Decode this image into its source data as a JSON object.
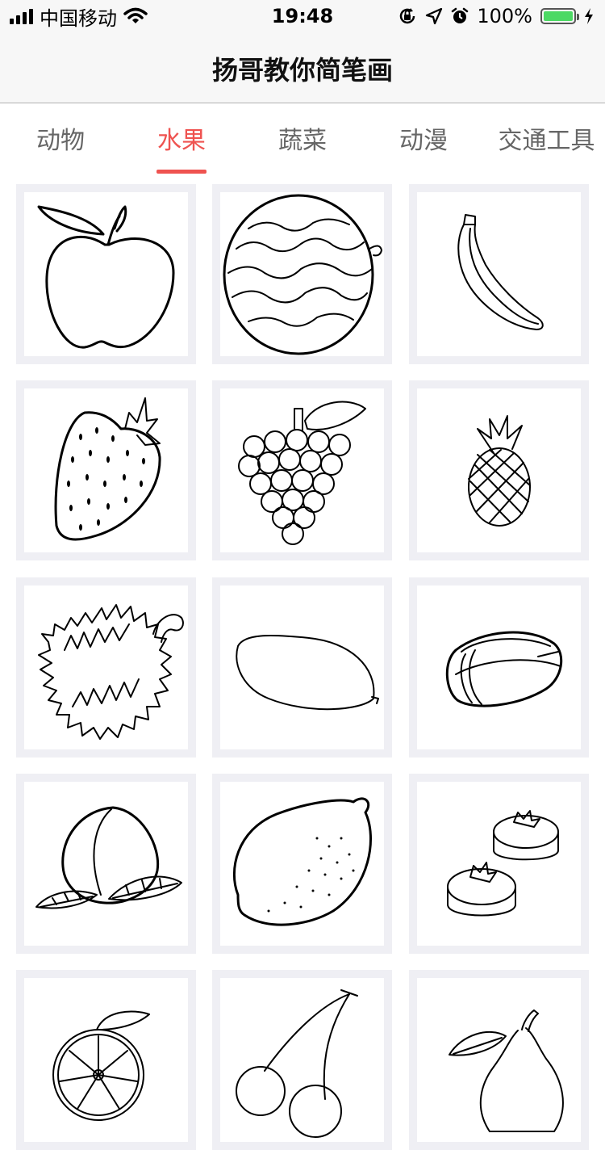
{
  "status_bar": {
    "carrier": "中国移动",
    "time": "19:48",
    "battery": "100%",
    "battery_level": 1.0
  },
  "nav": {
    "title": "扬哥教你简笔画"
  },
  "tabs": [
    {
      "label": "动物",
      "active": false
    },
    {
      "label": "水果",
      "active": true
    },
    {
      "label": "蔬菜",
      "active": false
    },
    {
      "label": "动漫",
      "active": false
    },
    {
      "label": "交通工具",
      "active": false
    }
  ],
  "colors": {
    "accent": "#ef5350",
    "card_border": "#efeff4",
    "nav_bg": "#f7f7f7"
  },
  "items": [
    {
      "icon": "apple-drawing"
    },
    {
      "icon": "watermelon-drawing"
    },
    {
      "icon": "banana-drawing"
    },
    {
      "icon": "strawberry-drawing"
    },
    {
      "icon": "grape-drawing"
    },
    {
      "icon": "pineapple-drawing"
    },
    {
      "icon": "durian-drawing"
    },
    {
      "icon": "mango-drawing"
    },
    {
      "icon": "starfruit-drawing"
    },
    {
      "icon": "peach-drawing"
    },
    {
      "icon": "lemon-drawing"
    },
    {
      "icon": "persimmon-drawing"
    },
    {
      "icon": "orange-drawing"
    },
    {
      "icon": "cherry-drawing"
    },
    {
      "icon": "pear-drawing"
    }
  ]
}
